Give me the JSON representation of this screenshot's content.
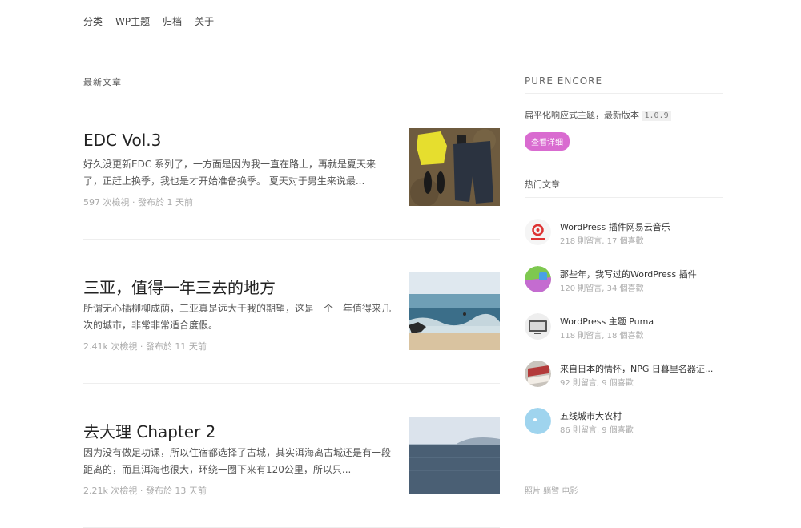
{
  "nav": {
    "items": [
      "分类",
      "WP主题",
      "归档",
      "关于"
    ]
  },
  "main": {
    "section_title": "最新文章",
    "posts": [
      {
        "title": "EDC Vol.3",
        "excerpt": "好久没更新EDC 系列了，一方面是因为我一直在路上，再就是夏天来了，正赶上换季，我也是才开始准备换季。 夏天对于男生来说最...",
        "meta": "597 次檢視 · 發布於 1 天前"
      },
      {
        "title": "三亚，值得一年三去的地方",
        "excerpt": "所谓无心插柳柳成荫，三亚真是远大于我的期望，这是一个一年值得来几次的城市，非常非常适合度假。",
        "meta": "2.41k 次檢視 · 發布於 11 天前"
      },
      {
        "title": "去大理 Chapter 2",
        "excerpt": "因为没有做足功课，所以住宿都选择了古城，其实洱海离古城还是有一段距离的，而且洱海也很大，环绕一圈下来有120公里，所以只...",
        "meta": "2.21k 次檢視 · 發布於 13 天前"
      }
    ]
  },
  "sidebar": {
    "brand": "PURE ENCORE",
    "desc": "扁平化响应式主题，最新版本",
    "version": "1.0.9",
    "button": "查看详细",
    "hot_title": "热门文章",
    "hot": [
      {
        "title": "WordPress 插件网易云音乐",
        "meta": "218 則留言, 17 個喜歡"
      },
      {
        "title": "那些年，我写过的WordPress 插件",
        "meta": "120 則留言, 34 個喜歡"
      },
      {
        "title": "WordPress 主题 Puma",
        "meta": "118 則留言, 18 個喜歡"
      },
      {
        "title": "来自日本的情怀，NPG 日暮里名器证...",
        "meta": "92 則留言, 9 個喜歡"
      },
      {
        "title": "五线城市大农村",
        "meta": "86 則留言, 9 個喜歡"
      }
    ],
    "footer": "照片 躺臂 电影"
  },
  "colors": {
    "accent": "#d96bd0",
    "border": "#eeeeee",
    "meta": "#aaaaaa"
  }
}
